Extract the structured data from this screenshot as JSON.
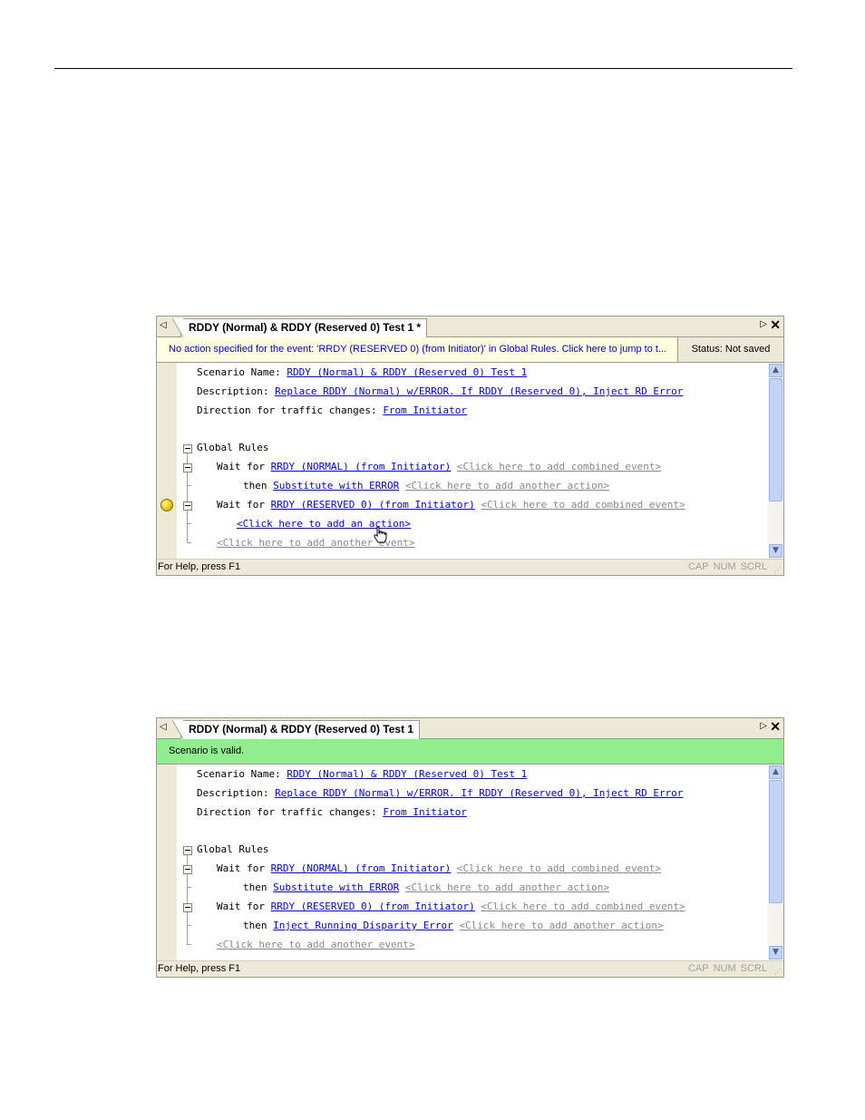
{
  "panels": [
    {
      "tab_title": "RDDY (Normal) & RDDY (Reserved 0) Test 1 *",
      "message": "No action specified for the event: 'RRDY (RESERVED 0) (from Initiator)' in Global Rules.  Click here to jump to t...",
      "save_status": "Status: Not saved",
      "scenario_label": "Scenario Name: ",
      "scenario_name": "RDDY (Normal) & RDDY (Reserved 0) Test 1",
      "description_label": "Description: ",
      "description": "Replace RDDY (Normal) w/ERROR. If RDDY (Reserved 0), Inject RD Error",
      "direction_label": "Direction for traffic changes: ",
      "direction": "From Initiator",
      "global_rules": "Global Rules",
      "wait_for": "Wait for ",
      "event1": "RRDY (NORMAL) (from Initiator)",
      "add_combined": "<Click here to add combined event>",
      "then": "then ",
      "action1": "Substitute with ERROR",
      "add_another_action": "<Click here to add another action>",
      "event2": "RRDY (RESERVED 0) (from Initiator)",
      "add_action": "<Click here to add an action>",
      "add_another_event": "<Click here to add another event>",
      "help": "For Help, press F1",
      "ind_cap": "CAP",
      "ind_num": "NUM",
      "ind_scrl": "SCRL"
    },
    {
      "tab_title": "RDDY (Normal) & RDDY (Reserved 0) Test 1",
      "message": "Scenario is valid.",
      "scenario_label": "Scenario Name: ",
      "scenario_name": "RDDY (Normal) & RDDY (Reserved 0) Test 1",
      "description_label": "Description: ",
      "description": "Replace RDDY (Normal) w/ERROR. If RDDY (Reserved 0), Inject RD Error",
      "direction_label": "Direction for traffic changes: ",
      "direction": "From Initiator",
      "global_rules": "Global Rules",
      "wait_for": "Wait for ",
      "event1": "RRDY (NORMAL) (from Initiator)",
      "add_combined": "<Click here to add combined event>",
      "then": "then ",
      "action1": "Substitute with ERROR",
      "add_another_action": "<Click here to add another action>",
      "event2": "RRDY (RESERVED 0) (from Initiator)",
      "action2": "Inject Running Disparity Error",
      "add_another_event": "<Click here to add another event>",
      "help": "For Help, press F1",
      "ind_cap": "CAP",
      "ind_num": "NUM",
      "ind_scrl": "SCRL"
    }
  ]
}
